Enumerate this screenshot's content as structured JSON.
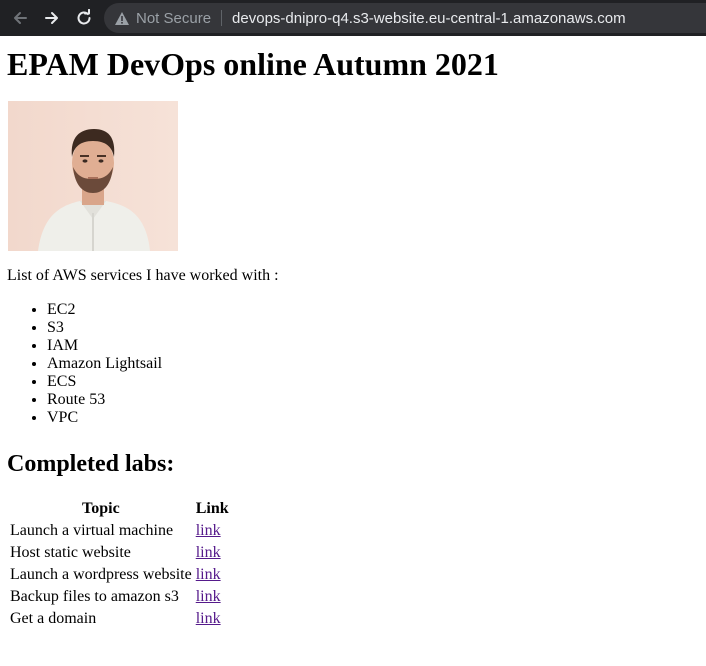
{
  "browser": {
    "security_label": "Not Secure",
    "url": "devops-dnipro-q4.s3-website.eu-central-1.amazonaws.com"
  },
  "page": {
    "title": "EPAM DevOps online Autumn 2021",
    "intro": "List of AWS services I have worked with :",
    "services": [
      "EC2",
      "S3",
      "IAM",
      "Amazon Lightsail",
      "ECS",
      "Route 53",
      "VPC"
    ],
    "labs_heading": "Completed labs:",
    "labs_table": {
      "headers": [
        "Topic",
        "Link"
      ],
      "rows": [
        {
          "topic": "Launch a virtual machine",
          "link": "link"
        },
        {
          "topic": "Host static website",
          "link": "link"
        },
        {
          "topic": "Launch a wordpress website",
          "link": "link"
        },
        {
          "topic": "Backup files to amazon s3",
          "link": "link"
        },
        {
          "topic": "Get a domain",
          "link": "link"
        }
      ]
    }
  },
  "colors": {
    "toolbar_bg": "#202124",
    "omnibox_bg": "#35363a",
    "visited_link": "#551a8b"
  }
}
